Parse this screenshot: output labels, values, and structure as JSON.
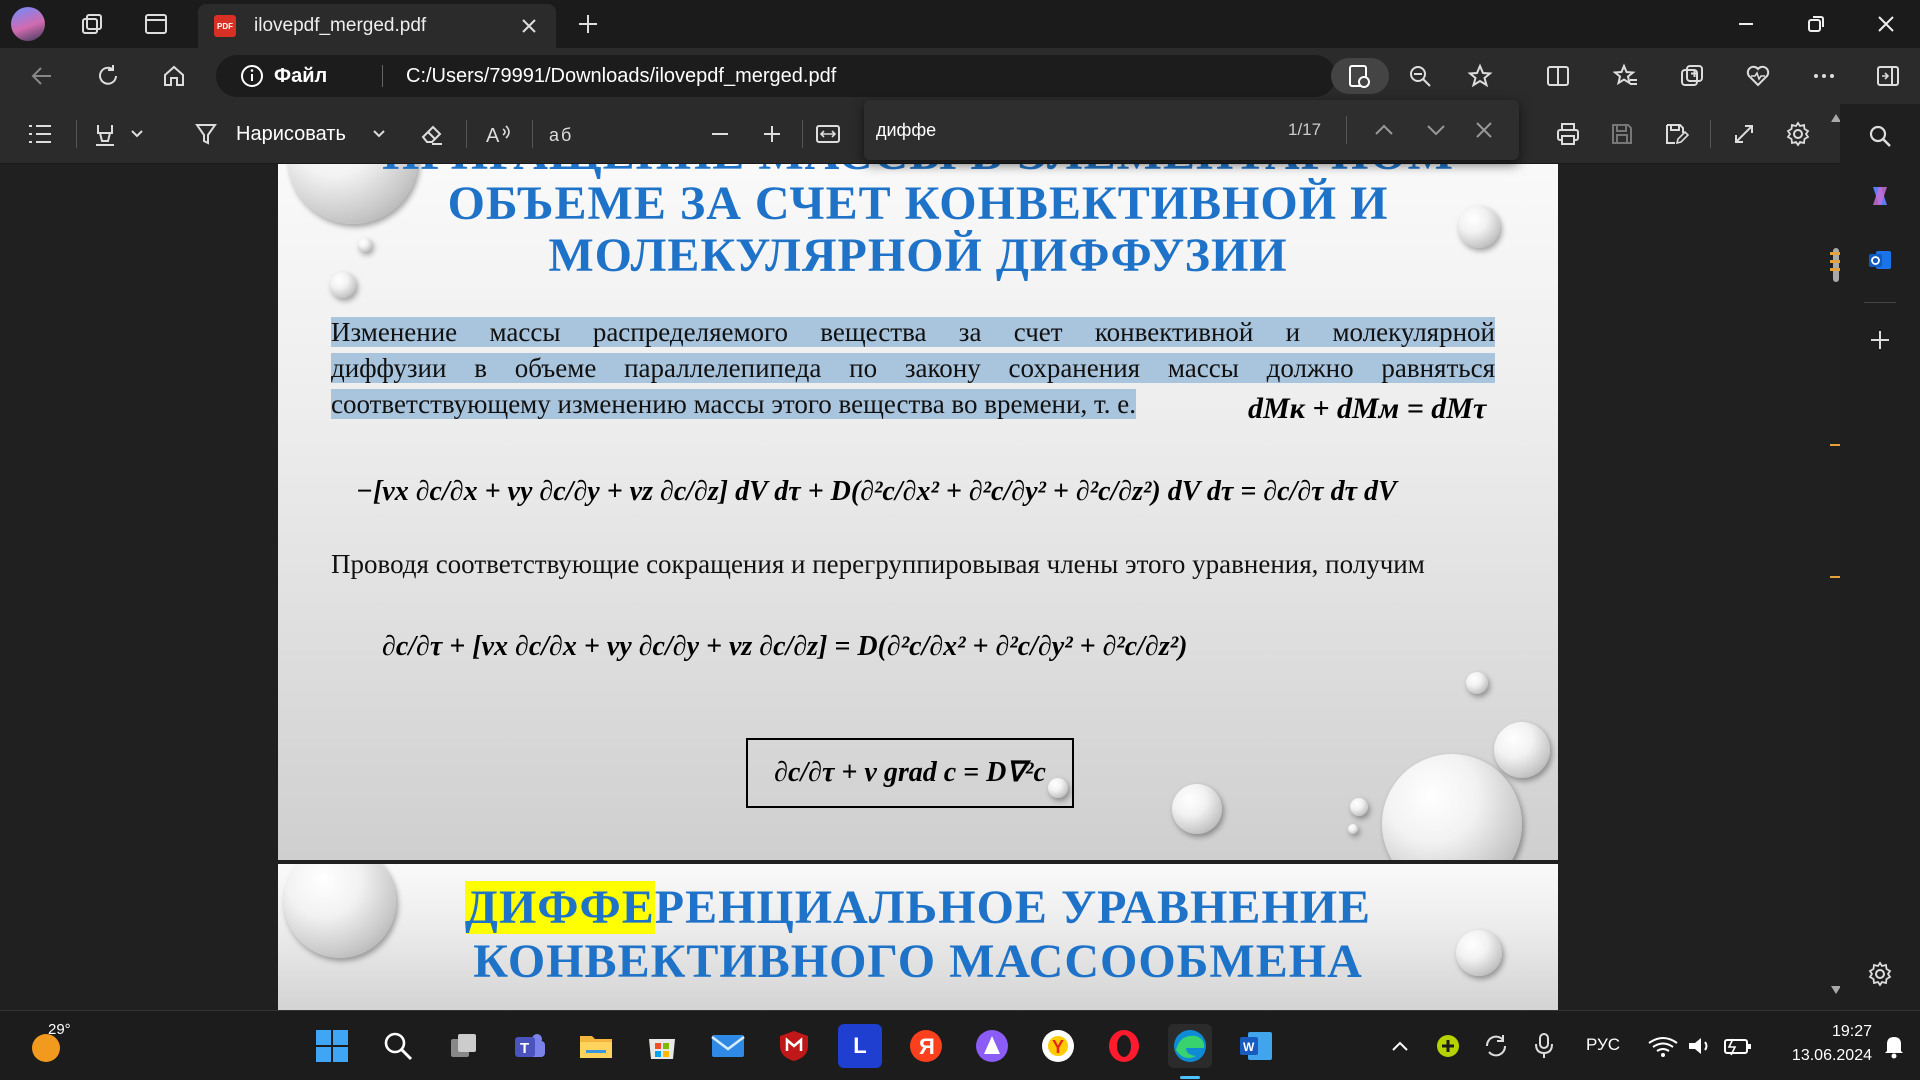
{
  "browser": {
    "tab": {
      "title": "ilovepdf_merged.pdf",
      "favicon_label": "PDF"
    },
    "address": {
      "scheme_label": "Файл",
      "url": "C:/Users/79991/Downloads/ilovepdf_merged.pdf"
    }
  },
  "pdf_toolbar": {
    "draw_label": "Нарисовать",
    "find_query": "диффе",
    "find_count": "1/17"
  },
  "slide1": {
    "title_line0": "ПРИРАЩЕНИЕ МАССЫ В ЭЛЕМЕНТАРНОМ",
    "title_line1": "ОБЪЕМЕ ЗА СЧЕТ КОНВЕКТИВНОЙ И",
    "title_line2": "МОЛЕКУЛЯРНОЙ ДИФФУЗИИ",
    "para_line1": "Изменение массы распределяемого вещества за счет конвективной и молекулярной",
    "para_line2": "диффузии в объеме параллелепипеда по закону сохранения массы должно равняться",
    "para_line3": "соответствующему изменению массы этого вещества во времени, т. е.",
    "eq_balance": "dMк + dMм = dMτ",
    "eq_full": "−[vx ∂c/∂x + vy ∂c/∂y + vz ∂c/∂z] dV dτ + D(∂²c/∂x² + ∂²c/∂y² + ∂²c/∂z²) dV dτ = ∂c/∂τ dτ dV",
    "para_line4": "Проводя соответствующие сокращения и перегруппировывая члены этого уравнения, получим",
    "eq_reduced": "∂c/∂τ + [vx ∂c/∂x + vy ∂c/∂y + vz ∂c/∂z] = D(∂²c/∂x² + ∂²c/∂y² + ∂²c/∂z²)",
    "eq_boxed": "∂c/∂τ + v grad c = D∇²c"
  },
  "slide2": {
    "title_highlight": "ДИФФЕ",
    "title_line1_rest": "РЕНЦИАЛЬНОЕ УРАВНЕНИЕ",
    "title_line2": "КОНВЕКТИВНОГО МАССООБМЕНА"
  },
  "taskbar": {
    "weather_temp": "29°",
    "lang": "РУС",
    "time": "19:27",
    "date": "13.06.2024"
  }
}
